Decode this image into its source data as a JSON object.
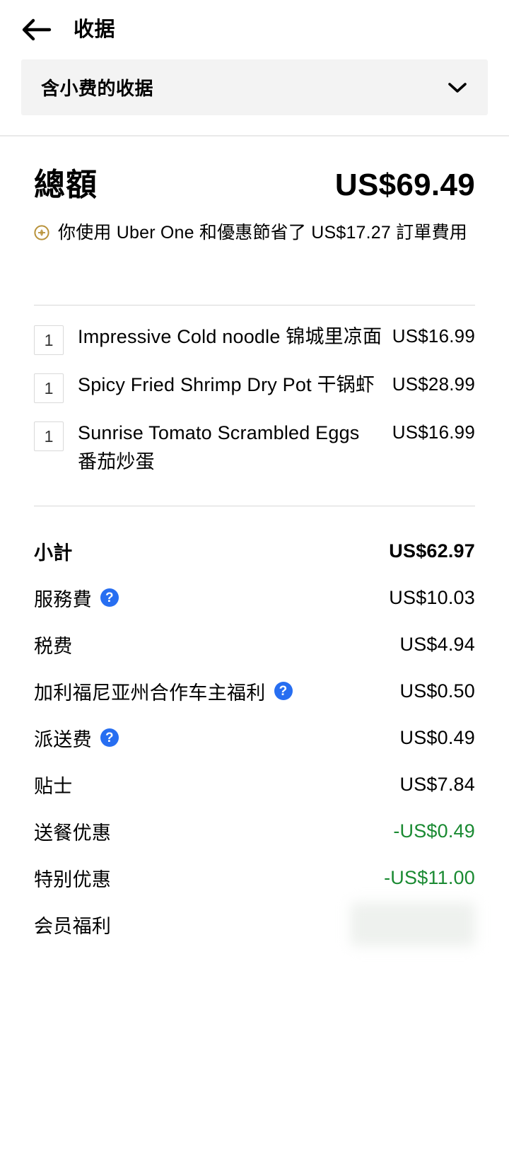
{
  "header": {
    "back_icon": "back-arrow-icon",
    "title": "收据"
  },
  "receipt_selector": {
    "label": "含小费的收据",
    "chevron_icon": "chevron-down-icon"
  },
  "total": {
    "label": "總額",
    "amount": "US$69.49"
  },
  "savings": {
    "badge_icon": "uber-one-savings-icon",
    "text": "你使用 Uber One 和優惠節省了 US$17.27 訂單費用"
  },
  "items": [
    {
      "qty": "1",
      "name": "Impressive Cold noodle 锦城里凉面",
      "price": "US$16.99"
    },
    {
      "qty": "1",
      "name": "Spicy Fried Shrimp Dry Pot 干锅虾",
      "price": "US$28.99"
    },
    {
      "qty": "1",
      "name": "Sunrise Tomato Scrambled Eggs 番茄炒蛋",
      "price": "US$16.99"
    }
  ],
  "fees": [
    {
      "label": "小計",
      "value": "US$62.97",
      "bold": true,
      "help": false,
      "green": false,
      "blurred": false
    },
    {
      "label": "服務費",
      "value": "US$10.03",
      "bold": false,
      "help": true,
      "green": false,
      "blurred": false
    },
    {
      "label": "税费",
      "value": "US$4.94",
      "bold": false,
      "help": false,
      "green": false,
      "blurred": false
    },
    {
      "label": "加利福尼亚州合作车主福利",
      "value": "US$0.50",
      "bold": false,
      "help": true,
      "green": false,
      "blurred": false
    },
    {
      "label": "派送费",
      "value": "US$0.49",
      "bold": false,
      "help": true,
      "green": false,
      "blurred": false
    },
    {
      "label": "贴士",
      "value": "US$7.84",
      "bold": false,
      "help": false,
      "green": false,
      "blurred": false
    },
    {
      "label": "送餐优惠",
      "value": "-US$0.49",
      "bold": false,
      "help": false,
      "green": true,
      "blurred": false
    },
    {
      "label": "特别优惠",
      "value": "-US$11.00",
      "bold": false,
      "help": false,
      "green": true,
      "blurred": false
    },
    {
      "label": "会员福利",
      "value": "",
      "bold": false,
      "help": false,
      "green": false,
      "blurred": true
    }
  ],
  "colors": {
    "accent_blue": "#276ef1",
    "discount_green": "#1a8a32",
    "selector_bg": "#f3f3f3",
    "badge_gold": "#b8923a"
  },
  "help_glyph": "?"
}
